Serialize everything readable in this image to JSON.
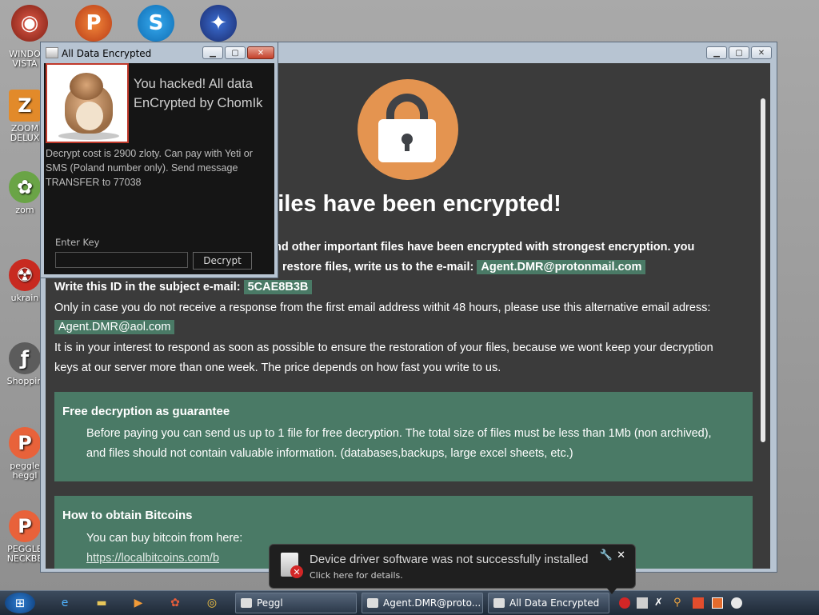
{
  "desktop": {
    "top_icons": [
      {
        "name": "window-icon"
      },
      {
        "name": "peggle-icon"
      },
      {
        "name": "skype-icon"
      },
      {
        "name": "browser-icon"
      }
    ],
    "icons": [
      {
        "label": "WINDO\nVISTA"
      },
      {
        "label": "ZOOM\nDELUX"
      },
      {
        "label": "zom"
      },
      {
        "label": "ukrain"
      },
      {
        "label": "Shoppin"
      },
      {
        "label": "peggle\nheggl"
      },
      {
        "label": "PEGGLE\nNECKBE"
      }
    ]
  },
  "main_window": {
    "headline": "r files have been encrypted!",
    "line1": "nd other important files have been encrypted with strongest encryption. you",
    "line2_text": "restore files, write us to the e-mail:",
    "email_primary": "Agent.DMR@protonmail.com",
    "id_label": "Write this ID in the subject e-mail:",
    "id_value": "5CAE8B3B",
    "alt_text": "Only in case you do not receive a response from the first email address withit 48 hours, please use this alternative email adress:",
    "email_alt": "Agent.DMR@aol.com",
    "interest_line1": "It is in your interest to respond as soon as possible to ensure the restoration of your files, because we wont keep your decryption",
    "interest_line2": "keys at our server more than one week. The price depends on how fast you write to us.",
    "panel1": {
      "title": "Free decryption as guarantee",
      "line1": "Before paying you can send us up to 1 file for free decryption. The total size of files must be less than 1Mb (non archived),",
      "line2": "and files should not contain valuable information. (databases,backups, large excel sheets, etc.)"
    },
    "panel2": {
      "title": "How to obtain Bitcoins",
      "line1": "You can buy bitcoin from here:",
      "link": "https://localbitcoins.com/b"
    }
  },
  "popup": {
    "title": "All Data Encrypted",
    "heading_line1": "You hacked! All data",
    "heading_line2": "EnCrypted by ChomIk",
    "body_line1": "Decrypt cost is 2900 zloty. Can pay with Yeti or",
    "body_line2": "SMS (Poland number only). Send message",
    "body_line3": "TRANSFER to 77038",
    "key_label": "Enter Key",
    "key_value": "",
    "decrypt_label": "Decrypt"
  },
  "notification": {
    "title": "Device driver software was not successfully installed",
    "subtitle": "Click here for details.",
    "close": "✕",
    "settings": "🔧"
  },
  "taskbar": {
    "tasks": [
      {
        "label": "Agent.DMR@proto..."
      },
      {
        "label": "All Data Encrypted"
      }
    ],
    "partial_task": "Peggl"
  }
}
